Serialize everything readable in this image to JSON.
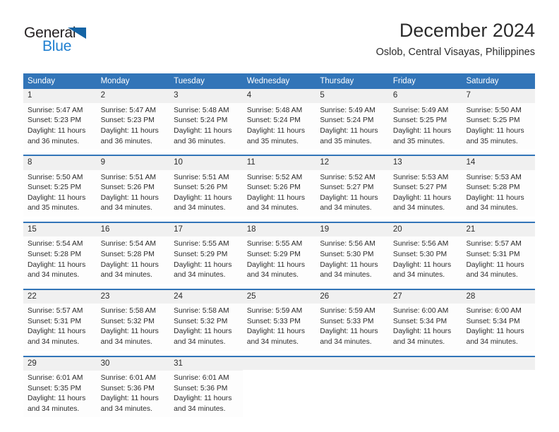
{
  "brand": {
    "name_top": "General",
    "name_bottom": "Blue"
  },
  "header": {
    "title": "December 2024",
    "location": "Oslob, Central Visayas, Philippines"
  },
  "calendar": {
    "weekdays": [
      "Sunday",
      "Monday",
      "Tuesday",
      "Wednesday",
      "Thursday",
      "Friday",
      "Saturday"
    ],
    "accent_color": "#3275b8",
    "daynum_band_color": "#f0f0f0",
    "weeks": [
      [
        {
          "day": "1",
          "sunrise": "Sunrise: 5:47 AM",
          "sunset": "Sunset: 5:23 PM",
          "daylight_1": "Daylight: 11 hours",
          "daylight_2": "and 36 minutes."
        },
        {
          "day": "2",
          "sunrise": "Sunrise: 5:47 AM",
          "sunset": "Sunset: 5:23 PM",
          "daylight_1": "Daylight: 11 hours",
          "daylight_2": "and 36 minutes."
        },
        {
          "day": "3",
          "sunrise": "Sunrise: 5:48 AM",
          "sunset": "Sunset: 5:24 PM",
          "daylight_1": "Daylight: 11 hours",
          "daylight_2": "and 36 minutes."
        },
        {
          "day": "4",
          "sunrise": "Sunrise: 5:48 AM",
          "sunset": "Sunset: 5:24 PM",
          "daylight_1": "Daylight: 11 hours",
          "daylight_2": "and 35 minutes."
        },
        {
          "day": "5",
          "sunrise": "Sunrise: 5:49 AM",
          "sunset": "Sunset: 5:24 PM",
          "daylight_1": "Daylight: 11 hours",
          "daylight_2": "and 35 minutes."
        },
        {
          "day": "6",
          "sunrise": "Sunrise: 5:49 AM",
          "sunset": "Sunset: 5:25 PM",
          "daylight_1": "Daylight: 11 hours",
          "daylight_2": "and 35 minutes."
        },
        {
          "day": "7",
          "sunrise": "Sunrise: 5:50 AM",
          "sunset": "Sunset: 5:25 PM",
          "daylight_1": "Daylight: 11 hours",
          "daylight_2": "and 35 minutes."
        }
      ],
      [
        {
          "day": "8",
          "sunrise": "Sunrise: 5:50 AM",
          "sunset": "Sunset: 5:25 PM",
          "daylight_1": "Daylight: 11 hours",
          "daylight_2": "and 35 minutes."
        },
        {
          "day": "9",
          "sunrise": "Sunrise: 5:51 AM",
          "sunset": "Sunset: 5:26 PM",
          "daylight_1": "Daylight: 11 hours",
          "daylight_2": "and 34 minutes."
        },
        {
          "day": "10",
          "sunrise": "Sunrise: 5:51 AM",
          "sunset": "Sunset: 5:26 PM",
          "daylight_1": "Daylight: 11 hours",
          "daylight_2": "and 34 minutes."
        },
        {
          "day": "11",
          "sunrise": "Sunrise: 5:52 AM",
          "sunset": "Sunset: 5:26 PM",
          "daylight_1": "Daylight: 11 hours",
          "daylight_2": "and 34 minutes."
        },
        {
          "day": "12",
          "sunrise": "Sunrise: 5:52 AM",
          "sunset": "Sunset: 5:27 PM",
          "daylight_1": "Daylight: 11 hours",
          "daylight_2": "and 34 minutes."
        },
        {
          "day": "13",
          "sunrise": "Sunrise: 5:53 AM",
          "sunset": "Sunset: 5:27 PM",
          "daylight_1": "Daylight: 11 hours",
          "daylight_2": "and 34 minutes."
        },
        {
          "day": "14",
          "sunrise": "Sunrise: 5:53 AM",
          "sunset": "Sunset: 5:28 PM",
          "daylight_1": "Daylight: 11 hours",
          "daylight_2": "and 34 minutes."
        }
      ],
      [
        {
          "day": "15",
          "sunrise": "Sunrise: 5:54 AM",
          "sunset": "Sunset: 5:28 PM",
          "daylight_1": "Daylight: 11 hours",
          "daylight_2": "and 34 minutes."
        },
        {
          "day": "16",
          "sunrise": "Sunrise: 5:54 AM",
          "sunset": "Sunset: 5:28 PM",
          "daylight_1": "Daylight: 11 hours",
          "daylight_2": "and 34 minutes."
        },
        {
          "day": "17",
          "sunrise": "Sunrise: 5:55 AM",
          "sunset": "Sunset: 5:29 PM",
          "daylight_1": "Daylight: 11 hours",
          "daylight_2": "and 34 minutes."
        },
        {
          "day": "18",
          "sunrise": "Sunrise: 5:55 AM",
          "sunset": "Sunset: 5:29 PM",
          "daylight_1": "Daylight: 11 hours",
          "daylight_2": "and 34 minutes."
        },
        {
          "day": "19",
          "sunrise": "Sunrise: 5:56 AM",
          "sunset": "Sunset: 5:30 PM",
          "daylight_1": "Daylight: 11 hours",
          "daylight_2": "and 34 minutes."
        },
        {
          "day": "20",
          "sunrise": "Sunrise: 5:56 AM",
          "sunset": "Sunset: 5:30 PM",
          "daylight_1": "Daylight: 11 hours",
          "daylight_2": "and 34 minutes."
        },
        {
          "day": "21",
          "sunrise": "Sunrise: 5:57 AM",
          "sunset": "Sunset: 5:31 PM",
          "daylight_1": "Daylight: 11 hours",
          "daylight_2": "and 34 minutes."
        }
      ],
      [
        {
          "day": "22",
          "sunrise": "Sunrise: 5:57 AM",
          "sunset": "Sunset: 5:31 PM",
          "daylight_1": "Daylight: 11 hours",
          "daylight_2": "and 34 minutes."
        },
        {
          "day": "23",
          "sunrise": "Sunrise: 5:58 AM",
          "sunset": "Sunset: 5:32 PM",
          "daylight_1": "Daylight: 11 hours",
          "daylight_2": "and 34 minutes."
        },
        {
          "day": "24",
          "sunrise": "Sunrise: 5:58 AM",
          "sunset": "Sunset: 5:32 PM",
          "daylight_1": "Daylight: 11 hours",
          "daylight_2": "and 34 minutes."
        },
        {
          "day": "25",
          "sunrise": "Sunrise: 5:59 AM",
          "sunset": "Sunset: 5:33 PM",
          "daylight_1": "Daylight: 11 hours",
          "daylight_2": "and 34 minutes."
        },
        {
          "day": "26",
          "sunrise": "Sunrise: 5:59 AM",
          "sunset": "Sunset: 5:33 PM",
          "daylight_1": "Daylight: 11 hours",
          "daylight_2": "and 34 minutes."
        },
        {
          "day": "27",
          "sunrise": "Sunrise: 6:00 AM",
          "sunset": "Sunset: 5:34 PM",
          "daylight_1": "Daylight: 11 hours",
          "daylight_2": "and 34 minutes."
        },
        {
          "day": "28",
          "sunrise": "Sunrise: 6:00 AM",
          "sunset": "Sunset: 5:34 PM",
          "daylight_1": "Daylight: 11 hours",
          "daylight_2": "and 34 minutes."
        }
      ],
      [
        {
          "day": "29",
          "sunrise": "Sunrise: 6:01 AM",
          "sunset": "Sunset: 5:35 PM",
          "daylight_1": "Daylight: 11 hours",
          "daylight_2": "and 34 minutes."
        },
        {
          "day": "30",
          "sunrise": "Sunrise: 6:01 AM",
          "sunset": "Sunset: 5:36 PM",
          "daylight_1": "Daylight: 11 hours",
          "daylight_2": "and 34 minutes."
        },
        {
          "day": "31",
          "sunrise": "Sunrise: 6:01 AM",
          "sunset": "Sunset: 5:36 PM",
          "daylight_1": "Daylight: 11 hours",
          "daylight_2": "and 34 minutes."
        },
        {
          "day": "",
          "sunrise": "",
          "sunset": "",
          "daylight_1": "",
          "daylight_2": ""
        },
        {
          "day": "",
          "sunrise": "",
          "sunset": "",
          "daylight_1": "",
          "daylight_2": ""
        },
        {
          "day": "",
          "sunrise": "",
          "sunset": "",
          "daylight_1": "",
          "daylight_2": ""
        },
        {
          "day": "",
          "sunrise": "",
          "sunset": "",
          "daylight_1": "",
          "daylight_2": ""
        }
      ]
    ]
  }
}
